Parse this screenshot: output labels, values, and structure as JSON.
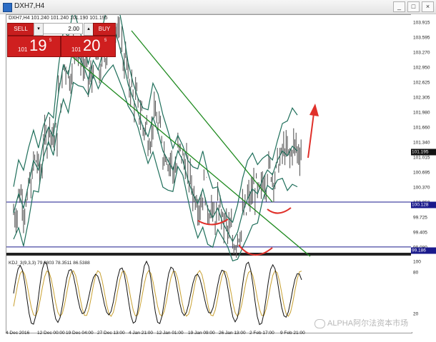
{
  "window": {
    "title": "DXH7,H4",
    "buttons": [
      "_",
      "□",
      "×"
    ]
  },
  "chart_header": {
    "symbol_line": "DXH7,H4  101.240 101.240 101.190 101.195"
  },
  "trade_panel": {
    "sell_label": "SELL",
    "buy_label": "BUY",
    "lot_value": "2.00",
    "sell_price": {
      "prefix": "101",
      "big": "19",
      "sup": "5"
    },
    "buy_price": {
      "prefix": "101",
      "big": "20",
      "sup": "5"
    }
  },
  "price_axis": {
    "ticks": [
      "103.915",
      "103.595",
      "103.270",
      "102.950",
      "102.625",
      "102.305",
      "101.980",
      "101.660",
      "101.340",
      "101.015",
      "100.695",
      "100.370",
      "100.050",
      "99.725",
      "99.405",
      "99.080"
    ],
    "tags": [
      {
        "text": "101.195",
        "dark": true,
        "value": 101.195
      },
      {
        "text": "100.128",
        "dark": false,
        "value": 100.128
      },
      {
        "text": "99.186",
        "dark": false,
        "value": 99.186
      }
    ]
  },
  "indicator": {
    "label": "KDJ_3(9,3,3) 79.0803 78.3511 86.5388",
    "ticks": [
      "100",
      "80",
      "20"
    ]
  },
  "time_axis": {
    "ticks": [
      "4 Dec 2016",
      "12 Dec 00:00",
      "19 Dec 04:00",
      "27 Dec 13:00",
      "4 Jan 21:00",
      "12 Jan 01:00",
      "19 Jan 09:00",
      "26 Jan 13:00",
      "2 Feb 17:00",
      "9 Feb 21:00"
    ]
  },
  "chart_data": {
    "type": "line",
    "series": [
      {
        "values": [
          99.9,
          100.3,
          100.0,
          100.5,
          101.0,
          100.8,
          101.4,
          101.7,
          101.5,
          102.4,
          103.0,
          102.8,
          103.4,
          103.2,
          103.0,
          102.7,
          103.1,
          102.9,
          103.3,
          103.6,
          103.8,
          103.5,
          103.1,
          102.6,
          102.3,
          102.0,
          101.7,
          101.5,
          101.9,
          101.6,
          101.2,
          101.0,
          100.8,
          101.2,
          101.0,
          100.6,
          100.3,
          100.1,
          100.4,
          100.0,
          99.8,
          100.0,
          99.7,
          99.5,
          99.3,
          99.5,
          99.9,
          100.2,
          100.4,
          100.3,
          100.6,
          100.8,
          100.7,
          101.0,
          101.2,
          101.1,
          101.3,
          101.2
        ]
      }
    ],
    "colors": {
      "candles": "#5a5a5a",
      "channel": "#1f8a1f",
      "bands": "#1e6e5a",
      "hline": "#1a1a8c",
      "annotation": "#e0302a",
      "kdj_k": "#111111",
      "kdj_d": "#c8a030"
    }
  }
}
